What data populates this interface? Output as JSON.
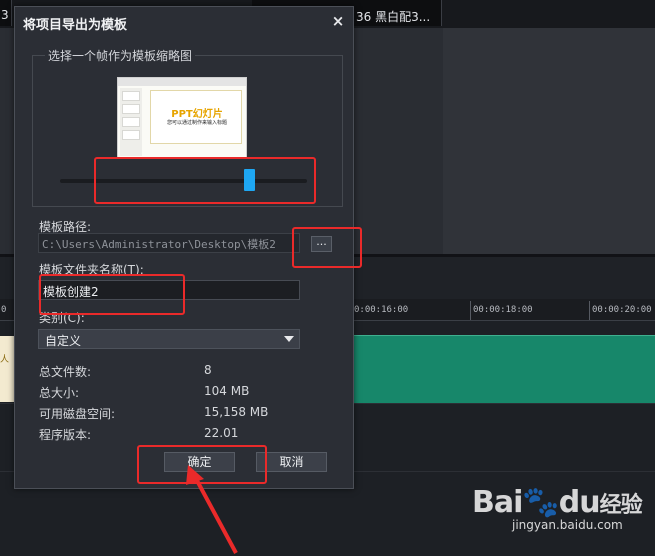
{
  "background": {
    "thumbnail_label": "36 黑白配3...",
    "thumbnail_left_label": "3",
    "ruler_ticks": [
      "0:00:16:00",
      "00:00:18:00",
      "00:00:20:00"
    ],
    "ruler_tick_prefix": "0",
    "clip_text": "人",
    "watermark_brand": "Bai",
    "watermark_brand_2": "du",
    "watermark_suffix": "经验",
    "watermark_url": "jingyan.baidu.com"
  },
  "dialog": {
    "title": "将项目导出为模板",
    "close_glyph": "×",
    "thumbnail_group_label": "选择一个帧作为模板缩略图",
    "preview": {
      "title": "PPT幻灯片",
      "subtitle": "您可以通过制作来输入标题"
    },
    "slider": {
      "position": 0.78
    },
    "path_label": "模板路径:",
    "path_value": "C:\\Users\\Administrator\\Desktop\\模板2",
    "browse_label": "...",
    "folder_name_label": "模板文件夹名称(T):",
    "folder_name_value": "模板创建2",
    "category_label": "类别(C):",
    "category_value": "自定义",
    "info": [
      {
        "key": "总文件数:",
        "value": "8"
      },
      {
        "key": "总大小:",
        "value": "104 MB"
      },
      {
        "key": "可用磁盘空间:",
        "value": "15,158 MB"
      },
      {
        "key": "程序版本:",
        "value": "22.01"
      }
    ],
    "ok_label": "确定",
    "cancel_label": "取消"
  },
  "colors": {
    "accent": "#1ea7f3",
    "annotation": "#ea2a2a",
    "clip": "#17876a"
  }
}
